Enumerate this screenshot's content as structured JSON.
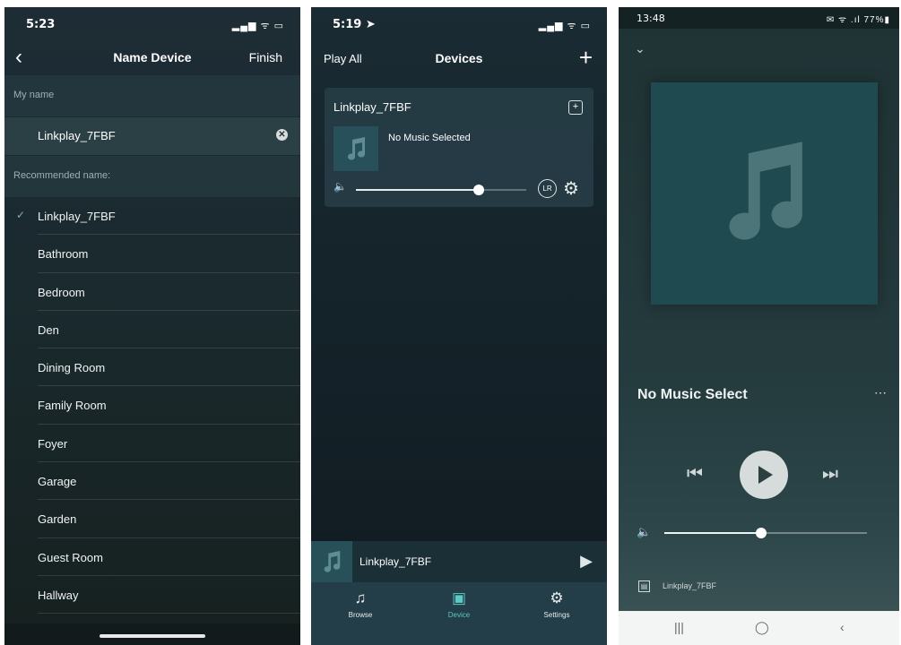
{
  "phone1": {
    "status": {
      "time": "5:23",
      "indicators": "▂▄▆ ᯤ ▭"
    },
    "nav": {
      "back_icon": "chevron-left-icon",
      "back_glyph": "‹",
      "title": "Name Device",
      "finish": "Finish"
    },
    "my_name_label": "My name",
    "name_value": "Linkplay_7FBF",
    "clear_glyph": "✕",
    "recommended_label": "Recommended name:",
    "check_glyph": "✓",
    "selected_index": 0,
    "recommended": [
      {
        "label": "Linkplay_7FBF"
      },
      {
        "label": "Bathroom"
      },
      {
        "label": "Bedroom"
      },
      {
        "label": "Den"
      },
      {
        "label": "Dining Room"
      },
      {
        "label": "Family Room"
      },
      {
        "label": "Foyer"
      },
      {
        "label": "Garage"
      },
      {
        "label": "Garden"
      },
      {
        "label": "Guest Room"
      },
      {
        "label": "Hallway"
      }
    ]
  },
  "phone2": {
    "status": {
      "time": "5:19 ➤",
      "indicators": "▂▄▆ ᯤ ▭"
    },
    "nav": {
      "play_all": "Play All",
      "title": "Devices",
      "add_glyph": "+"
    },
    "card": {
      "device_name": "Linkplay_7FBF",
      "group_glyph": "+",
      "now_playing": "No Music Selected",
      "volume_glyph": "🔈",
      "volume_level": 0.72,
      "lr_label": "LR",
      "settings_glyph": "⚙"
    },
    "mini_player": {
      "device_name": "Linkplay_7FBF",
      "play_glyph": "▶"
    },
    "tabs": [
      {
        "label": "Browse",
        "glyph": "♫",
        "icon": "music-note-icon"
      },
      {
        "label": "Device",
        "glyph": "▣",
        "icon": "speaker-icon"
      },
      {
        "label": "Settings",
        "glyph": "⚙",
        "icon": "gear-icon"
      }
    ],
    "active_tab": "Device"
  },
  "phone3": {
    "status": {
      "time": "13:48",
      "indicators": "✉ ᯤ .ıl 77%▮"
    },
    "collapse_glyph": "⌄",
    "title": "No Music Select",
    "more_glyph": "⋯",
    "prev_glyph": "⏮",
    "next_glyph": "⏭",
    "volume_glyph": "🔈",
    "volume_level": 0.48,
    "device_glyph": "▤",
    "device_name": "Linkplay_7FBF",
    "nav_buttons": {
      "recents": "|||",
      "home": "◯",
      "back": "‹"
    }
  },
  "colors": {
    "accent": "#5ec8c1",
    "card": "#283e48",
    "tabbar": "#233d49"
  }
}
